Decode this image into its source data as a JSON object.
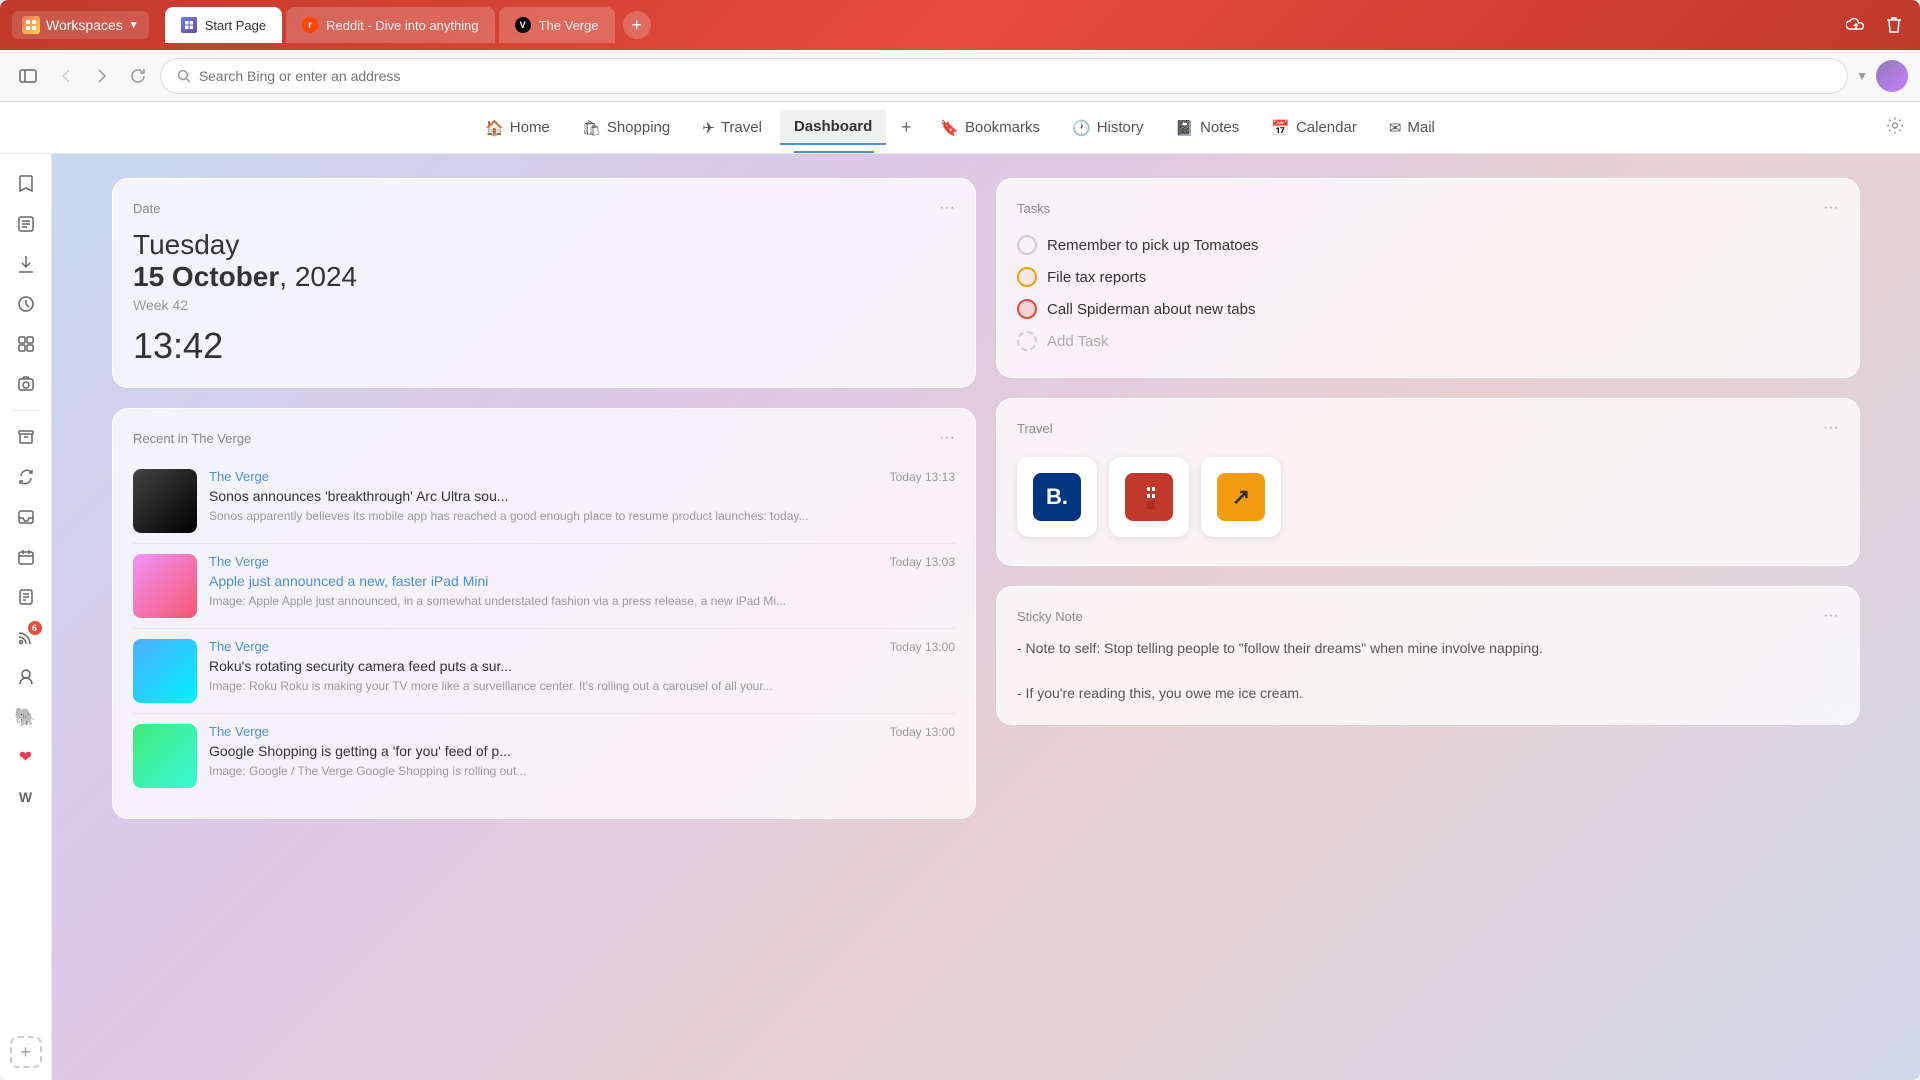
{
  "browser": {
    "workspaces_label": "Workspaces",
    "tabs": [
      {
        "id": "start",
        "label": "Start Page",
        "favicon_type": "start",
        "active": true
      },
      {
        "id": "reddit",
        "label": "Reddit - Dive into anything",
        "favicon_type": "reddit",
        "active": false
      },
      {
        "id": "verge",
        "label": "The Verge",
        "favicon_type": "verge",
        "active": false
      }
    ],
    "search_placeholder": "Search Bing or enter an address"
  },
  "navbar": {
    "items": [
      {
        "id": "home",
        "label": "Home",
        "icon": "🏠"
      },
      {
        "id": "shopping",
        "label": "Shopping",
        "icon": "🛍"
      },
      {
        "id": "travel",
        "label": "Travel",
        "icon": "✈"
      },
      {
        "id": "dashboard",
        "label": "Dashboard",
        "icon": ""
      },
      {
        "id": "bookmarks",
        "label": "Bookmarks",
        "icon": "🔖"
      },
      {
        "id": "history",
        "label": "History",
        "icon": "🕐"
      },
      {
        "id": "notes",
        "label": "Notes",
        "icon": "📓"
      },
      {
        "id": "calendar",
        "label": "Calendar",
        "icon": "📅"
      },
      {
        "id": "mail",
        "label": "Mail",
        "icon": "✉"
      }
    ],
    "active": "dashboard"
  },
  "date_card": {
    "title": "Date",
    "day": "Tuesday",
    "date_bold": "15 October",
    "date_year": ", 2024",
    "week": "Week 42",
    "time": "13:42"
  },
  "tasks_card": {
    "title": "Tasks",
    "tasks": [
      {
        "text": "Remember to pick up Tomatoes",
        "status": "normal"
      },
      {
        "text": "File tax reports",
        "status": "yellow"
      },
      {
        "text": "Call Spiderman about new tabs",
        "status": "red"
      }
    ],
    "add_label": "Add Task"
  },
  "recent_card": {
    "title": "Recent in The Verge",
    "items": [
      {
        "source": "The Verge",
        "time": "Today 13:13",
        "title": "Sonos announces 'breakthrough' Arc Ultra sou...",
        "desc": "Sonos apparently believes its mobile app has reached a good enough place to resume product launches: today...",
        "thumb": "t1"
      },
      {
        "source": "The Verge",
        "time": "Today 13:03",
        "title": "Apple just announced a new, faster iPad Mini",
        "desc": "Image: Apple Apple just announced, in a somewhat understated fashion via a press release, a new iPad Mi...",
        "thumb": "t2",
        "title_color": "link"
      },
      {
        "source": "The Verge",
        "time": "Today 13:00",
        "title": "Roku's rotating security camera feed puts a sur...",
        "desc": "Image: Roku Roku is making your TV more like a surveillance center. It's rolling out a carousel of all your...",
        "thumb": "t3"
      },
      {
        "source": "The Verge",
        "time": "Today 13:00",
        "title": "Google Shopping is getting a 'for you' feed of p...",
        "desc": "Image: Google / The Verge Google Shopping is rolling out...",
        "thumb": "t4"
      }
    ]
  },
  "travel_card": {
    "title": "Travel",
    "icons": [
      {
        "id": "booking",
        "label": "B.",
        "type": "booking"
      },
      {
        "id": "hotels",
        "label": "H",
        "type": "hotels"
      },
      {
        "id": "arrow",
        "label": "↗",
        "type": "arrow"
      }
    ]
  },
  "sticky_card": {
    "title": "Sticky Note",
    "lines": [
      "- Note to self: Stop telling people to \"follow their dreams\" when mine involve napping.",
      "",
      "- If you're reading this, you owe me ice cream."
    ]
  }
}
